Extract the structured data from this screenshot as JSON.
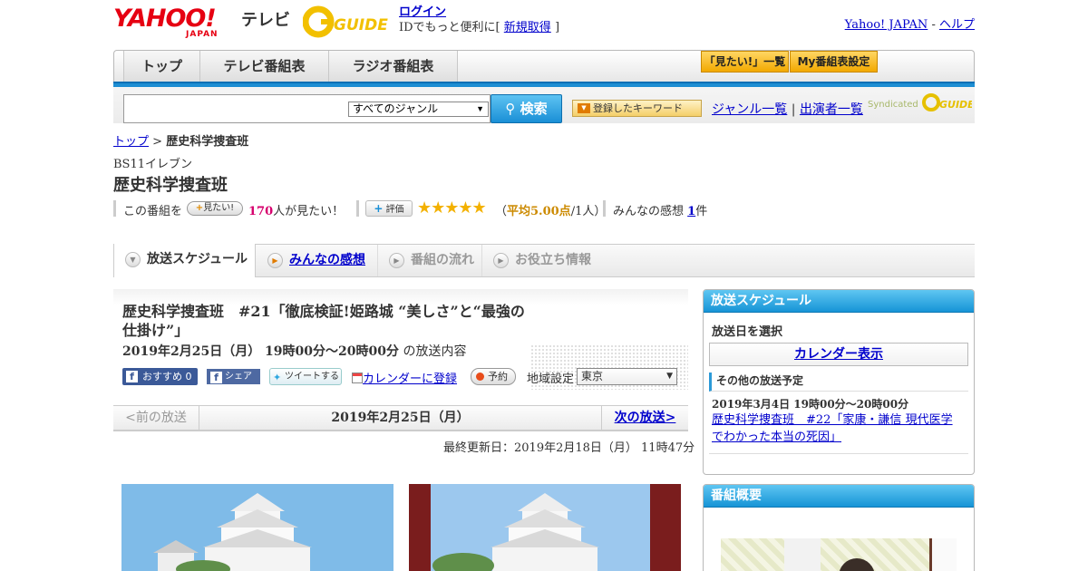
{
  "header": {
    "yahoo_logo": "YAHOO!",
    "yahoo_japan": "JAPAN",
    "tv_label": "テレビ",
    "gguide_logo": "GUIDE",
    "login": "ログイン",
    "login_sub_prefix": "IDでもっと便利に[",
    "register": "新規取得",
    "login_sub_suffix": "]",
    "yahoo_japan_link": "Yahoo! JAPAN",
    "separator": "-",
    "help": "ヘルプ"
  },
  "nav": {
    "tabs": [
      "トップ",
      "テレビ番組表",
      "ラジオ番組表"
    ],
    "mitai_list": "「見たい!」一覧",
    "my_table": "My番組表設定"
  },
  "search": {
    "genre_selected": "すべてのジャンル",
    "search_button": "検索",
    "keyword_button": "登録したキーワード",
    "genre_list": "ジャンル一覧",
    "links_sep": "|",
    "cast_list": "出演者一覧",
    "syndicated": "Syndicated"
  },
  "breadcrumb": {
    "top": "トップ",
    "sep": ">",
    "current": "歴史科学捜査班"
  },
  "program": {
    "channel": "BS11イレブン",
    "title": "歴史科学捜査班",
    "mitai_prefix": "この番組を",
    "mitai_button": "見たい!",
    "mitai_count": "170",
    "mitai_suffix": "人が見たい！",
    "hyoka_button": "評価",
    "stars": "★★★★★",
    "rating_open": "（",
    "rating_avg": "平均5.00点",
    "rating_count": "/1人）",
    "kanso_label": "みんなの感想",
    "kanso_count": "1",
    "kanso_unit": "件"
  },
  "subtabs": [
    "放送スケジュール",
    "みんなの感想",
    "番組の流れ",
    "お役立ち情報"
  ],
  "episode": {
    "title": "歴史科学捜査班　#21「徹底検証!姫路城 “美しさ”と“最強の仕掛け”」",
    "date": "2019年2月25日（月） 19時00分～20時00分",
    "date_suffix": "の放送内容",
    "fb_recommend": "おすすめ 0",
    "fb_share": "シェア",
    "tweet": "ツイートする",
    "calendar": "カレンダーに登録",
    "reserve": "予約",
    "region_label": "地域設定",
    "region_value": "東京"
  },
  "pager": {
    "prev": "<前の放送",
    "current": "2019年2月25日（月）",
    "next": "次の放送>"
  },
  "updated": "最終更新日：2019年2月18日（月） 11時47分",
  "sidebar": {
    "schedule_title": "放送スケジュール",
    "select_date": "放送日を選択",
    "calendar_button": "カレンダー表示",
    "other_label": "その他の放送予定",
    "other_date": "2019年3月4日 19時00分～20時00分",
    "other_episode": "歴史科学捜査班　#22「家康・謙信 現代医学でわかった本当の死因」",
    "overview_title": "番組概要"
  },
  "colors": {
    "accent_blue": "#1d8ed3",
    "link": "#0000cc",
    "star": "#f3b100",
    "pink": "#d6006d"
  }
}
